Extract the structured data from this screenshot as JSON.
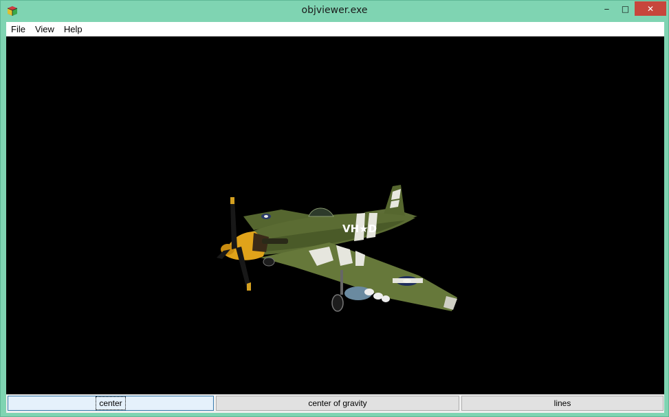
{
  "window": {
    "title": "objviewer.exe",
    "controls": {
      "minimize": "‒",
      "maximize": "□",
      "close": "✕"
    }
  },
  "menu": {
    "items": [
      "File",
      "View",
      "Help"
    ]
  },
  "viewport": {
    "background": "#000000",
    "model_markings": "VH★D"
  },
  "bottom_buttons": {
    "center": "center",
    "center_of_gravity": "center of gravity",
    "lines": "lines"
  },
  "colors": {
    "frame": "#7fd4b2",
    "close_button": "#c7463c",
    "aircraft_green": "#5a6b34",
    "nose_yellow": "#e0a31a"
  }
}
